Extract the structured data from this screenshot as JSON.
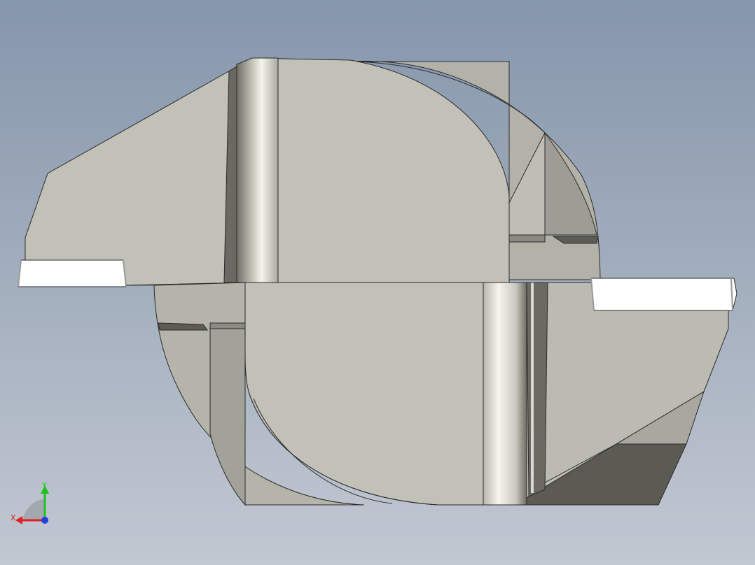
{
  "viewport": {
    "background_top": "#8696ab",
    "background_bottom": "#c2c8d2"
  },
  "model": {
    "face_color": "#c1c1b8",
    "shadow_color": "#5c5c54",
    "highlight_color": "#ffffff"
  },
  "triad": {
    "x_label": "X",
    "y_label": "Y",
    "x_color": "#e02020",
    "y_color": "#20c020",
    "z_color": "#2040e0"
  }
}
